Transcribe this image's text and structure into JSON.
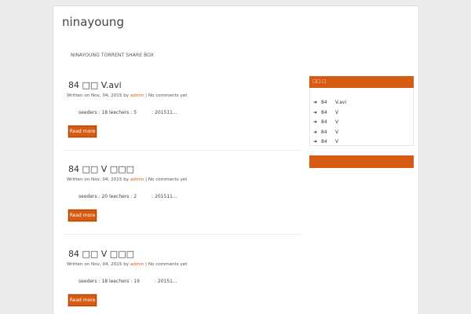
{
  "site": {
    "title": "ninayoung",
    "description": "NINAYOUNG TORRENT SHARE BOX"
  },
  "posts": [
    {
      "title": "84 □□ V.avi",
      "meta_prefix": "Written on Nov, 04, 2015 by",
      "author": "admin",
      "separator": " | ",
      "comments": "No comments yet",
      "excerpt": "seeders : 18 leechers : 5          : 201511...",
      "read_more": "Read more"
    },
    {
      "title": "84 □□ V □□□",
      "meta_prefix": "Written on Nov, 04, 2015 by",
      "author": "admin",
      "separator": " | ",
      "comments": "No comments yet",
      "excerpt": "seeders : 20 leechers : 2          : 201511...",
      "read_more": "Read more"
    },
    {
      "title": "84 □□ V □□□",
      "meta_prefix": "Written on Nov, 04, 2015 by",
      "author": "admin",
      "separator": " | ",
      "comments": "No comments yet",
      "excerpt": "seeders : 18 leechers : 19          : 20151...",
      "read_more": "Read more"
    }
  ],
  "sidebar": {
    "widget_title": "□□ □",
    "items": [
      {
        "num": "84",
        "text": "V.avi"
      },
      {
        "num": "84",
        "text": "V"
      },
      {
        "num": "84",
        "text": "V"
      },
      {
        "num": "84",
        "text": "V"
      },
      {
        "num": "84",
        "text": "V"
      }
    ]
  },
  "colors": {
    "accent": "#d75b12",
    "background": "#ececec"
  }
}
